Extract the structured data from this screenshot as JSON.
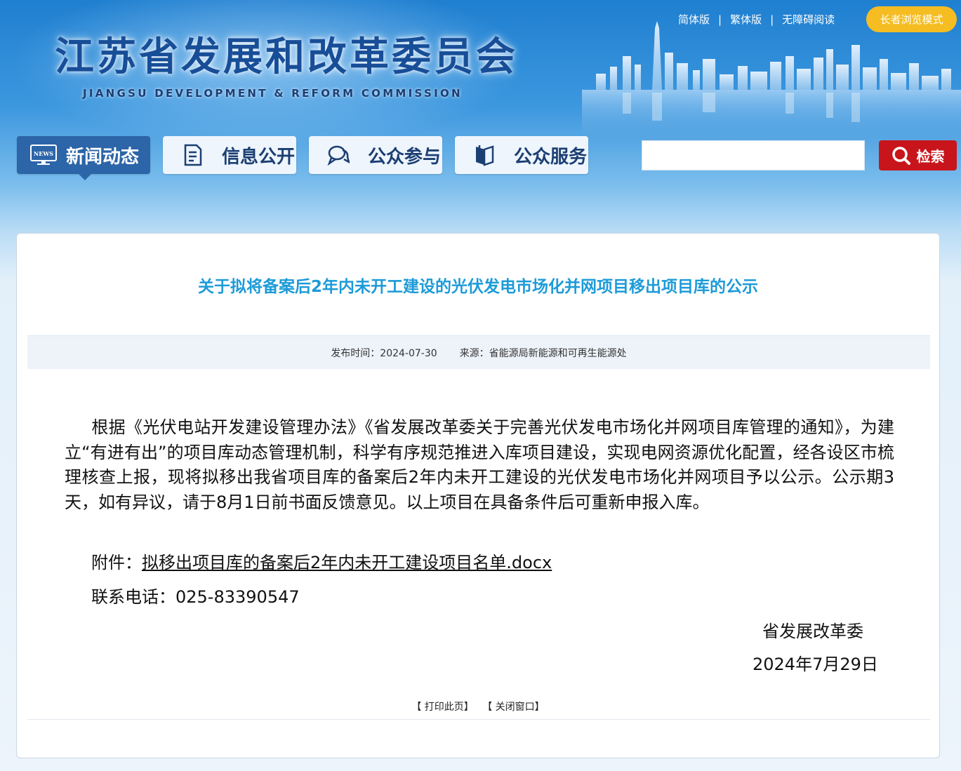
{
  "header": {
    "logo_cn": "江苏省发展和改革委员会",
    "logo_en": "JIANGSU DEVELOPMENT & REFORM COMMISSION",
    "links": [
      "简体版",
      "繁体版",
      "无障碍阅读"
    ],
    "separator": "|",
    "elder_mode": "长者浏览模式"
  },
  "nav": {
    "items": [
      {
        "label": "新闻动态",
        "icon": "news-icon"
      },
      {
        "label": "信息公开",
        "icon": "document-icon"
      },
      {
        "label": "公众参与",
        "icon": "chat-icon"
      },
      {
        "label": "公众服务",
        "icon": "book-icon"
      }
    ]
  },
  "search": {
    "value": "",
    "placeholder": "",
    "button_label": "检索"
  },
  "article": {
    "title": "关于拟将备案后2年内未开工建设的光伏发电市场化并网项目移出项目库的公示",
    "publish_time": "发布时间：2024-07-30",
    "source": "来源：省能源局新能源和可再生能源处",
    "body": "根据《光伏电站开发建设管理办法》《省发展改革委关于完善光伏发电市场化并网项目库管理的通知》，为建立“有进有出”的项目库动态管理机制，科学有序规范推进入库项目建设，实现电网资源优化配置，经各设区市梳理核查上报，现将拟移出我省项目库的备案后2年内未开工建设的光伏发电市场化并网项目予以公示。公示期3天，如有异议，请于8月1日前书面反馈意见。以上项目在具备条件后可重新申报入库。",
    "attachment_label": "附件：",
    "attachment_link": "拟移出项目库的备案后2年内未开工建设项目名单.docx",
    "contact": "联系电话：025-83390547",
    "signature": "省发展改革委",
    "date": "2024年7月29日"
  },
  "footer_links": {
    "print": "【 打印此页】",
    "close": "【 关闭窗口】"
  },
  "colors": {
    "title": "#1d9bd8",
    "nav_active": "#2c65a8",
    "search_button": "#c8151b",
    "elder_button": "#f5bd22"
  }
}
